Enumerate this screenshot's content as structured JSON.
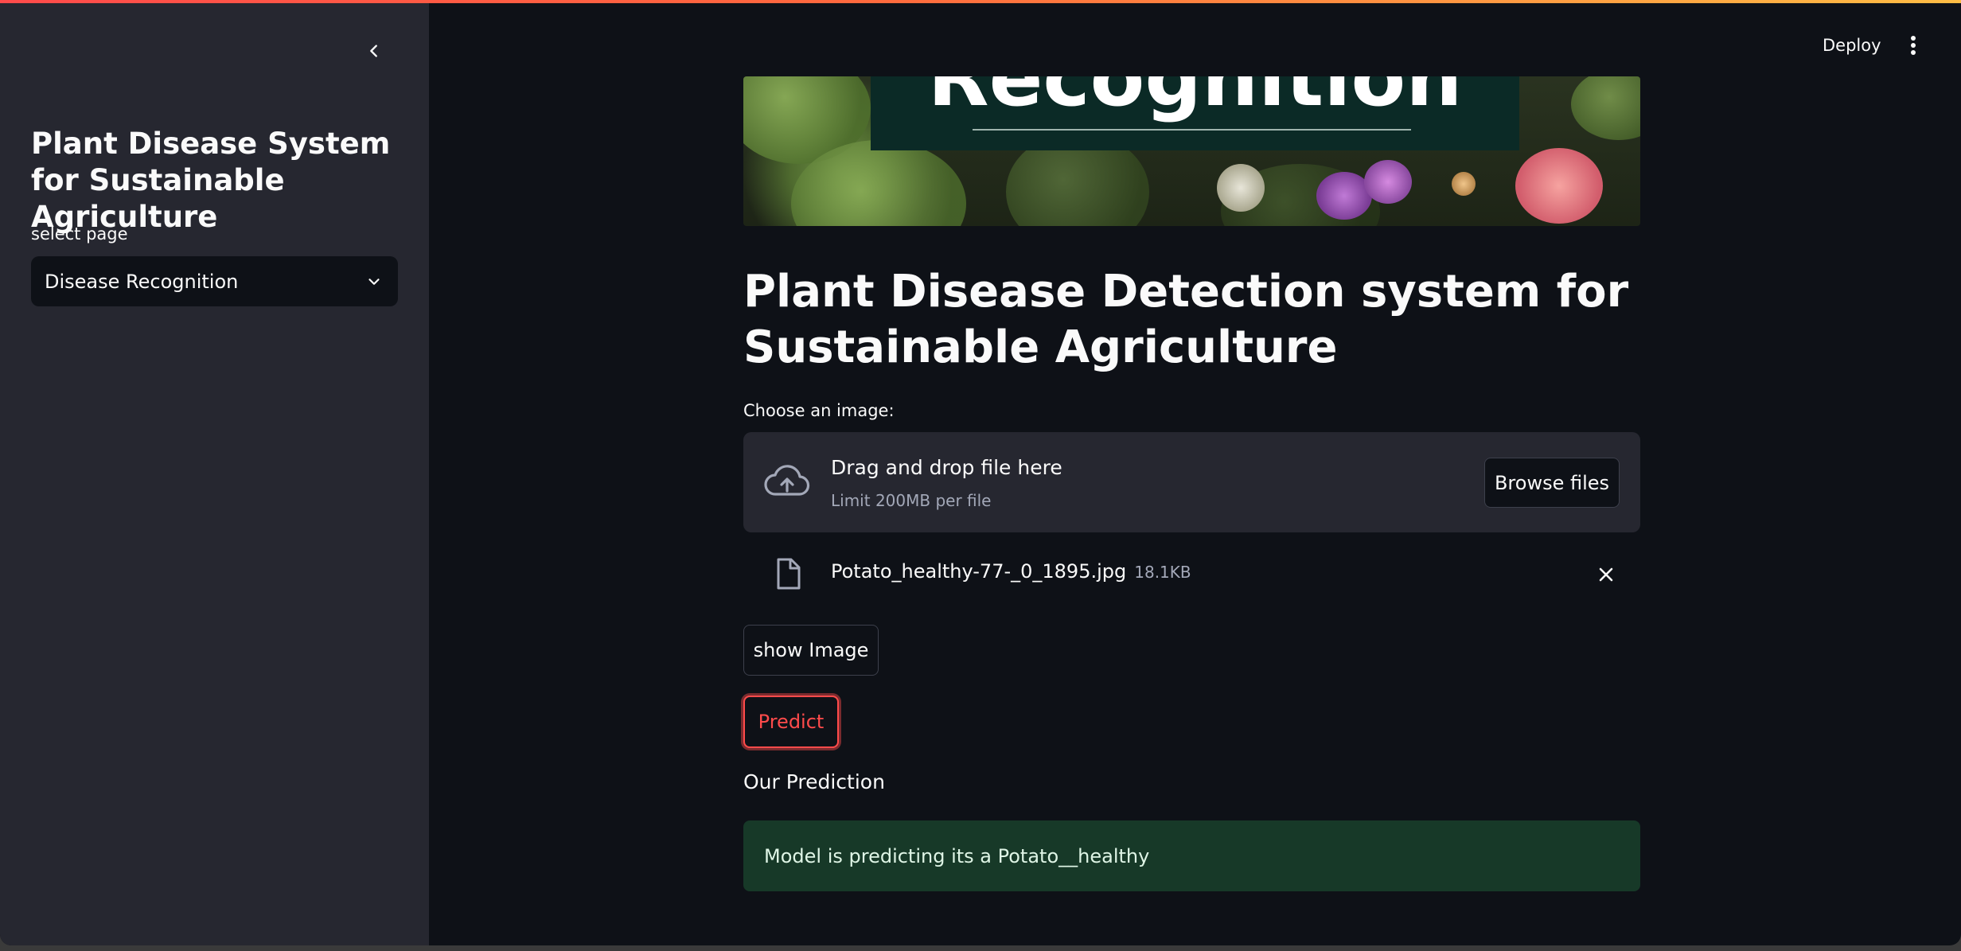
{
  "sidebar": {
    "title": "Plant Disease System for Sustainable Agriculture",
    "select_label": "select page",
    "select_value": "Disease Recognition"
  },
  "header": {
    "deploy_label": "Deploy"
  },
  "banner": {
    "overlay_text": "Recognition"
  },
  "main": {
    "heading": "Plant Disease Detection system for Sustainable Agriculture",
    "uploader": {
      "label": "Choose an image:",
      "drop_title": "Drag and drop file here",
      "drop_limit": "Limit 200MB per file",
      "browse_label": "Browse files"
    },
    "file": {
      "name": "Potato_healthy-77-_0_1895.jpg",
      "size": "18.1KB"
    },
    "show_image_label": "show Image",
    "predict_label": "Predict",
    "prediction_heading": "Our Prediction",
    "prediction_result": "Model is predicting its a Potato__healthy"
  },
  "colors": {
    "background": "#0e1117",
    "sidebar": "#262730",
    "accent": "#ff4b4b",
    "success_bg": "#173928"
  }
}
